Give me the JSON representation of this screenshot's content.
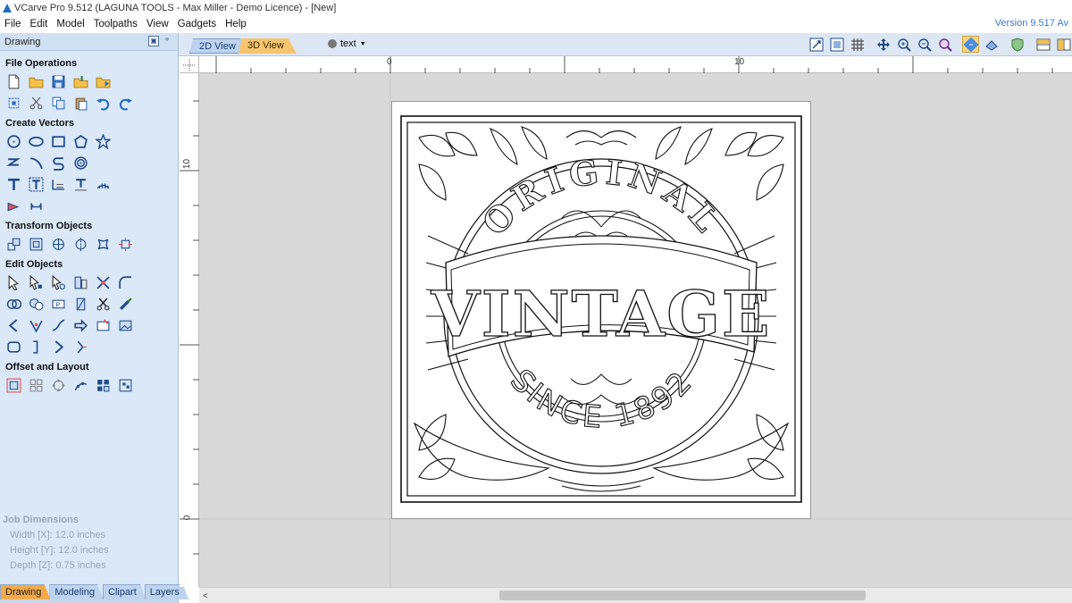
{
  "window": {
    "title": "VCarve Pro 9.512 (LAGUNA TOOLS - Max Miller  - Demo Licence) - [New]",
    "version_badge": "Version 9.517 Av"
  },
  "menu": [
    "File",
    "Edit",
    "Model",
    "Toolpaths",
    "View",
    "Gadgets",
    "Help"
  ],
  "sidebar": {
    "header": "Drawing",
    "sections": {
      "file_operations": "File Operations",
      "create_vectors": "Create Vectors",
      "transform_objects": "Transform Objects",
      "edit_objects": "Edit Objects",
      "offset_layout": "Offset and Layout"
    },
    "job_dimensions": {
      "title": "Job Dimensions",
      "width": "Width  [X]: 12.0 inches",
      "height": "Height [Y]: 12.0 inches",
      "depth": "Depth  [Z]: 0.75 inches"
    },
    "tabs": [
      "Drawing",
      "Modeling",
      "Clipart",
      "Layers"
    ],
    "active_tab": "Drawing"
  },
  "toolbar": {
    "view_tabs": [
      "2D View",
      "3D View"
    ],
    "active_view": "2D View",
    "layer": "text"
  },
  "rulers": {
    "h_labels": [
      "0",
      "10"
    ],
    "v_labels": [
      "10",
      "0"
    ]
  },
  "design": {
    "top_text": "ORIGINAL",
    "banner_text": "VINTAGE",
    "bottom_text": "SINCE 1892"
  },
  "colors": {
    "sidebar_bg": "#dbe8f7",
    "active_tab": "#f3a94a",
    "canvas_bg": "#d9d9d9",
    "version_text": "#3a7bd5"
  }
}
